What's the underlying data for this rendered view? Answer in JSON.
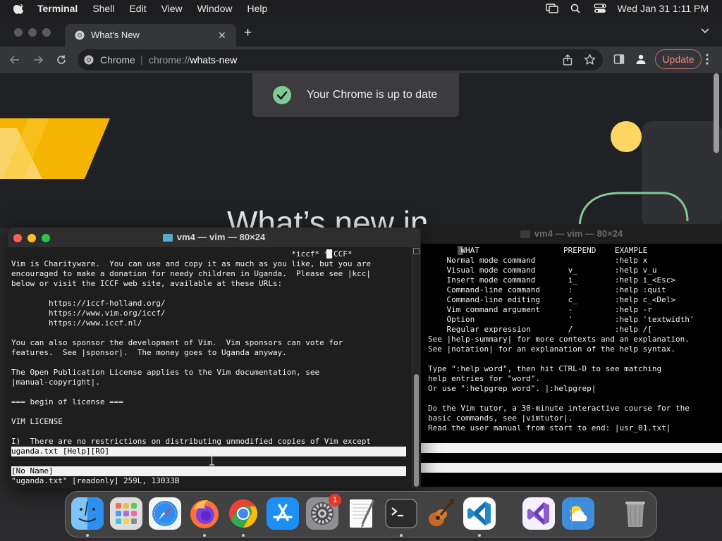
{
  "menubar": {
    "app_name": "Terminal",
    "items": [
      "Shell",
      "Edit",
      "View",
      "Window",
      "Help"
    ],
    "clock": "Wed Jan 31  1:11 PM"
  },
  "chrome": {
    "tab_title": "What's New",
    "site_label": "Chrome",
    "url_scheme": "chrome://",
    "url_host": "whats-new",
    "update_label": "Update",
    "toast_message": "Your Chrome is up to date",
    "hero_text": "What’s new in"
  },
  "terminal_back": {
    "title": "vm4 — vim — 80×24",
    "lines": [
      "       WHAT                  PREPEND    EXAMPLE",
      "    Normal mode command                 :help x",
      "    Visual mode command       v_        :help v_u",
      "    Insert mode command       i_        :help i_<Esc>",
      "    Command-line command      :         :help :quit",
      "    Command-line editing      c_        :help c_<Del>",
      "    Vim command argument      -         :help -r",
      "    Option                    '         :help 'textwidth'",
      "    Regular expression        /         :help /[",
      "See |help-summary| for more contexts and an explanation.",
      "See |notation| for an explanation of the help syntax.",
      "",
      "Type \":help word\", then hit CTRL-D to see matching",
      "help entries for \"word\".",
      "Or use \":helpgrep word\". |:helpgrep|",
      "",
      "Do the Vim tutor, a 30-minute interactive course for the",
      "basic commands, see |vimtutor|.",
      "Read the user manual from start to end: |usr_01.txt|"
    ]
  },
  "terminal_front": {
    "title": "vm4 — vim — 80×24",
    "tag_line": "                                                            *iccf* *ICCF*",
    "lines": [
      "Vim is Charityware.  You can use and copy it as much as you like, but you are",
      "encouraged to make a donation for needy children in Uganda.  Please see |kcc|",
      "below or visit the ICCF web site, available at these URLs:",
      "",
      "        https://iccf-holland.org/",
      "        https://www.vim.org/iccf/",
      "        https://www.iccf.nl/",
      "",
      "You can also sponsor the development of Vim.  Vim sponsors can vote for",
      "features.  See |sponsor|.  The money goes to Uganda anyway.",
      "",
      "The Open Publication License applies to the Vim documentation, see",
      "|manual-copyright|.",
      "",
      "=== begin of license ===",
      "",
      "VIM LICENSE",
      "",
      "I)  There are no restrictions on distributing unmodified copies of Vim except"
    ],
    "status_top": "uganda.txt [Help][RO]",
    "status_bottom": "[No Name]",
    "cmdline": "\"uganda.txt\" [readonly] 259L, 13033B"
  },
  "dock": {
    "items": [
      "Finder",
      "Launchpad",
      "Safari",
      "Firefox",
      "Google Chrome",
      "App Store",
      "System Settings",
      "TextEdit",
      "Terminal",
      "Garage Band",
      "Visual Studio Code",
      "Visual Studio",
      "Weather",
      "Trash"
    ],
    "settings_badge": "1"
  }
}
